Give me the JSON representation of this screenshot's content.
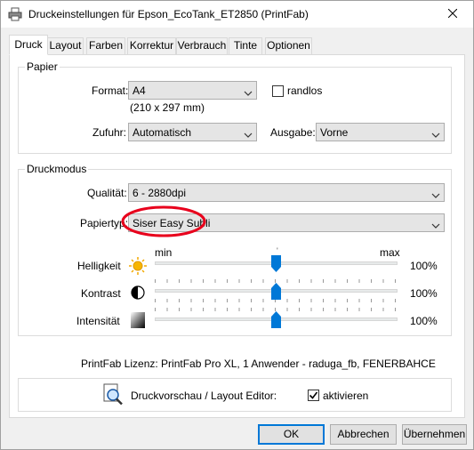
{
  "window": {
    "title": "Druckeinstellungen für Epson_EcoTank_ET2850 (PrintFab)"
  },
  "tabs": [
    {
      "label": "Druck",
      "active": true
    },
    {
      "label": "Layout"
    },
    {
      "label": "Farben"
    },
    {
      "label": "Korrektur"
    },
    {
      "label": "Verbrauch"
    },
    {
      "label": "Tinte"
    },
    {
      "label": "Optionen"
    }
  ],
  "papier": {
    "legend": "Papier",
    "format_label": "Format:",
    "format_value": "A4",
    "format_size": "(210 x 297 mm)",
    "randlos_label": "randlos",
    "randlos_checked": false,
    "zufuhr_label": "Zufuhr:",
    "zufuhr_value": "Automatisch",
    "ausgabe_label": "Ausgabe:",
    "ausgabe_value": "Vorne"
  },
  "druckmodus": {
    "legend": "Druckmodus",
    "qualitaet_label": "Qualität:",
    "qualitaet_value": "6 - 2880dpi",
    "papiertyp_label": "Papiertyp:",
    "papiertyp_value": "Siser Easy Subli",
    "scale_min": "min",
    "scale_max": "max",
    "sliders": [
      {
        "label": "Helligkeit",
        "value": "100%",
        "level": 0.5,
        "icon": "sun-icon"
      },
      {
        "label": "Kontrast",
        "value": "100%",
        "level": 0.5,
        "icon": "contrast-icon"
      },
      {
        "label": "Intensität",
        "value": "100%",
        "level": 0.5,
        "icon": "gradient-icon"
      }
    ]
  },
  "license_text": "PrintFab Lizenz: PrintFab Pro XL, 1 Anwender - raduga_fb, FENERBAHCE",
  "preview": {
    "label": "Druckvorschau / Layout Editor:",
    "activate_label": "aktivieren",
    "activate_checked": true
  },
  "buttons": {
    "ok": "OK",
    "cancel": "Abbrechen",
    "apply": "Übernehmen"
  },
  "colors": {
    "accent": "#0078d7",
    "annotation": "#e8001c",
    "thumb": "#0078d7"
  }
}
